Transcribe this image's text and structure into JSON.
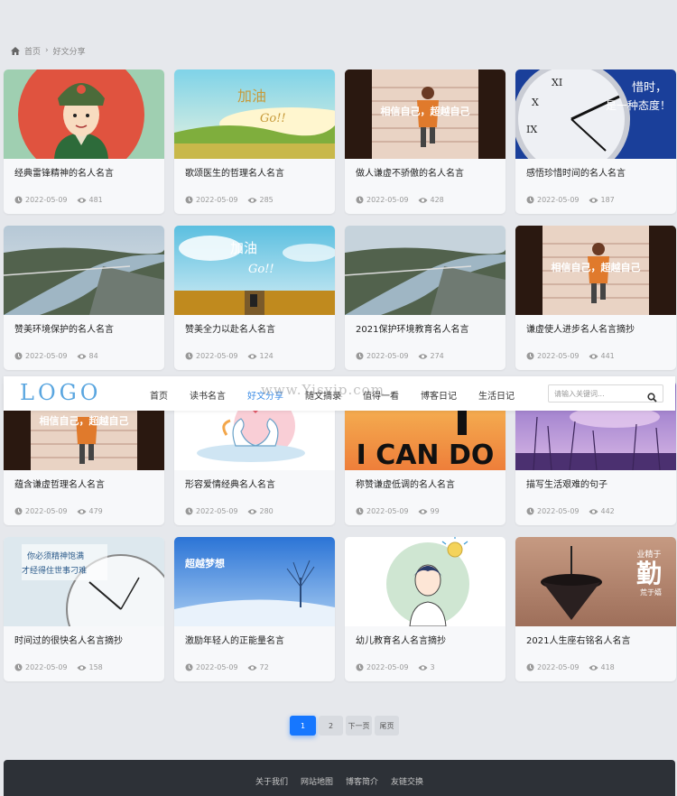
{
  "breadcrumb": {
    "home": "首页",
    "separator": "›",
    "current": "好文分享"
  },
  "nav": {
    "logo": "LOGO",
    "watermark": "www.Yisvip.com",
    "links": [
      "首页",
      "读书名言",
      "好文分享",
      "随文摘录",
      "值得一看",
      "博客日记",
      "生活日记"
    ],
    "active_index": 2,
    "search_placeholder": "请输入关键词...",
    "search_icon": "search-icon"
  },
  "cards": [
    {
      "title": "经典雷锋精神的名人名言",
      "date": "2022-05-09",
      "views": "481"
    },
    {
      "title": "歌颂医生的哲理名人名言",
      "date": "2022-05-09",
      "views": "285"
    },
    {
      "title": "做人谦虚不骄傲的名人名言",
      "date": "2022-05-09",
      "views": "428"
    },
    {
      "title": "感悟珍惜时间的名人名言",
      "date": "2022-05-09",
      "views": "187"
    },
    {
      "title": "赞美环境保护的名人名言",
      "date": "2022-05-09",
      "views": "84"
    },
    {
      "title": "赞美全力以赴名人名言",
      "date": "2022-05-09",
      "views": "124"
    },
    {
      "title": "2021保护环境教育名人名言",
      "date": "2022-05-09",
      "views": "274"
    },
    {
      "title": "谦虚使人进步名人名言摘抄",
      "date": "2022-05-09",
      "views": "441"
    },
    {
      "title": "蕴含谦虚哲理名人名言",
      "date": "2022-05-09",
      "views": "479"
    },
    {
      "title": "形容爱情经典名人名言",
      "date": "2022-05-09",
      "views": "280"
    },
    {
      "title": "称赞谦虚低调的名人名言",
      "date": "2022-05-09",
      "views": "99"
    },
    {
      "title": "描写生活艰难的句子",
      "date": "2022-05-09",
      "views": "442"
    },
    {
      "title": "时间过的很快名人名言摘抄",
      "date": "2022-05-09",
      "views": "158"
    },
    {
      "title": "激励年轻人的正能量名言",
      "date": "2022-05-09",
      "views": "72"
    },
    {
      "title": "幼儿教育名人名言摘抄",
      "date": "2022-05-09",
      "views": "3"
    },
    {
      "title": "2021人生座右铭名人名言",
      "date": "2022-05-09",
      "views": "418"
    }
  ],
  "thumb_text": {
    "cheer": "加油",
    "go": "Go!!",
    "stairs": "相信自己，超越自己",
    "clock_line1": "惜时，",
    "clock_line2": "是一种态度！",
    "i_can_do": "I CAN DO",
    "spirit_line1": "你必须精神饱满",
    "spirit_line2": "才经得住世事刁难",
    "dream": "超越梦想",
    "diligence_small": "业精于",
    "diligence_big": "勤",
    "diligence_sub": "荒于嬉"
  },
  "pagination": {
    "pages": [
      "1",
      "2"
    ],
    "current": "1",
    "next": "下一页",
    "last": "尾页"
  },
  "footer": {
    "links": [
      "关于我们",
      "网站地图",
      "博客简介",
      "友链交换"
    ]
  },
  "colors": {
    "accent": "#3d8de6",
    "page_active": "#1677ff",
    "footer_bg": "#2d3137",
    "page_bg": "#e6e8ec"
  }
}
